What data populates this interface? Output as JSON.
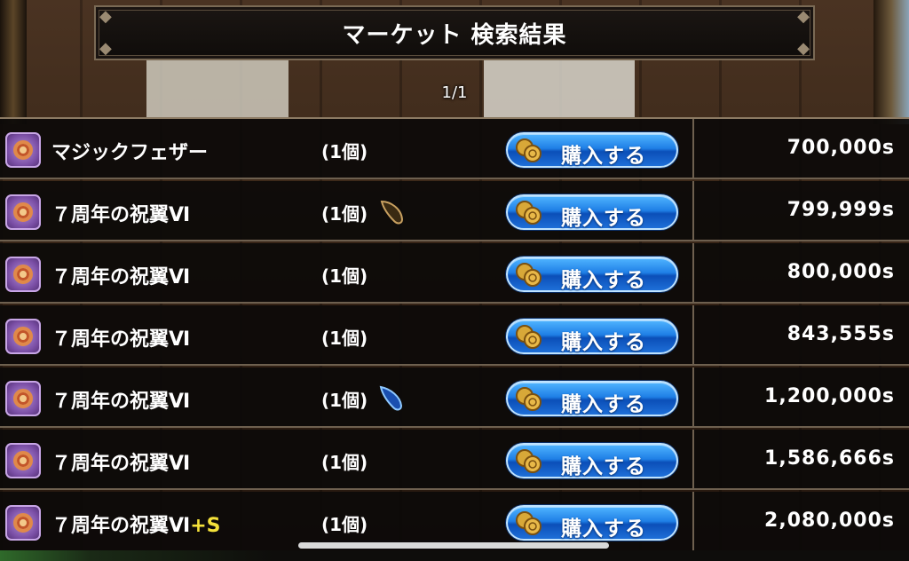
{
  "header": {
    "title": "マーケット 検索結果",
    "page_indicator": "1/1"
  },
  "listings": [
    {
      "name": "マジックフェザー",
      "suffix": "",
      "quantity": "(1個)",
      "attribute_icon": "",
      "buy_label": "購入する",
      "price": "700,000s"
    },
    {
      "name": "７周年の祝翼Ⅵ",
      "suffix": "",
      "quantity": "(1個)",
      "attribute_icon": "brown-feather-icon",
      "buy_label": "購入する",
      "price": "799,999s"
    },
    {
      "name": "７周年の祝翼Ⅵ",
      "suffix": "",
      "quantity": "(1個)",
      "attribute_icon": "",
      "buy_label": "購入する",
      "price": "800,000s"
    },
    {
      "name": "７周年の祝翼Ⅵ",
      "suffix": "",
      "quantity": "(1個)",
      "attribute_icon": "",
      "buy_label": "購入する",
      "price": "843,555s"
    },
    {
      "name": "７周年の祝翼Ⅵ",
      "suffix": "",
      "quantity": "(1個)",
      "attribute_icon": "blue-drop-icon",
      "buy_label": "購入する",
      "price": "1,200,000s"
    },
    {
      "name": "７周年の祝翼Ⅵ",
      "suffix": "",
      "quantity": "(1個)",
      "attribute_icon": "",
      "buy_label": "購入する",
      "price": "1,586,666s"
    },
    {
      "name": "７周年の祝翼Ⅵ",
      "suffix": "+S",
      "quantity": "(1個)",
      "attribute_icon": "",
      "buy_label": "購入する",
      "price": "2,080,000s"
    }
  ],
  "colors": {
    "buy_button": "#1f7fe6",
    "suffix": "#f5e23a",
    "item_icon": "#7b4fa6"
  }
}
